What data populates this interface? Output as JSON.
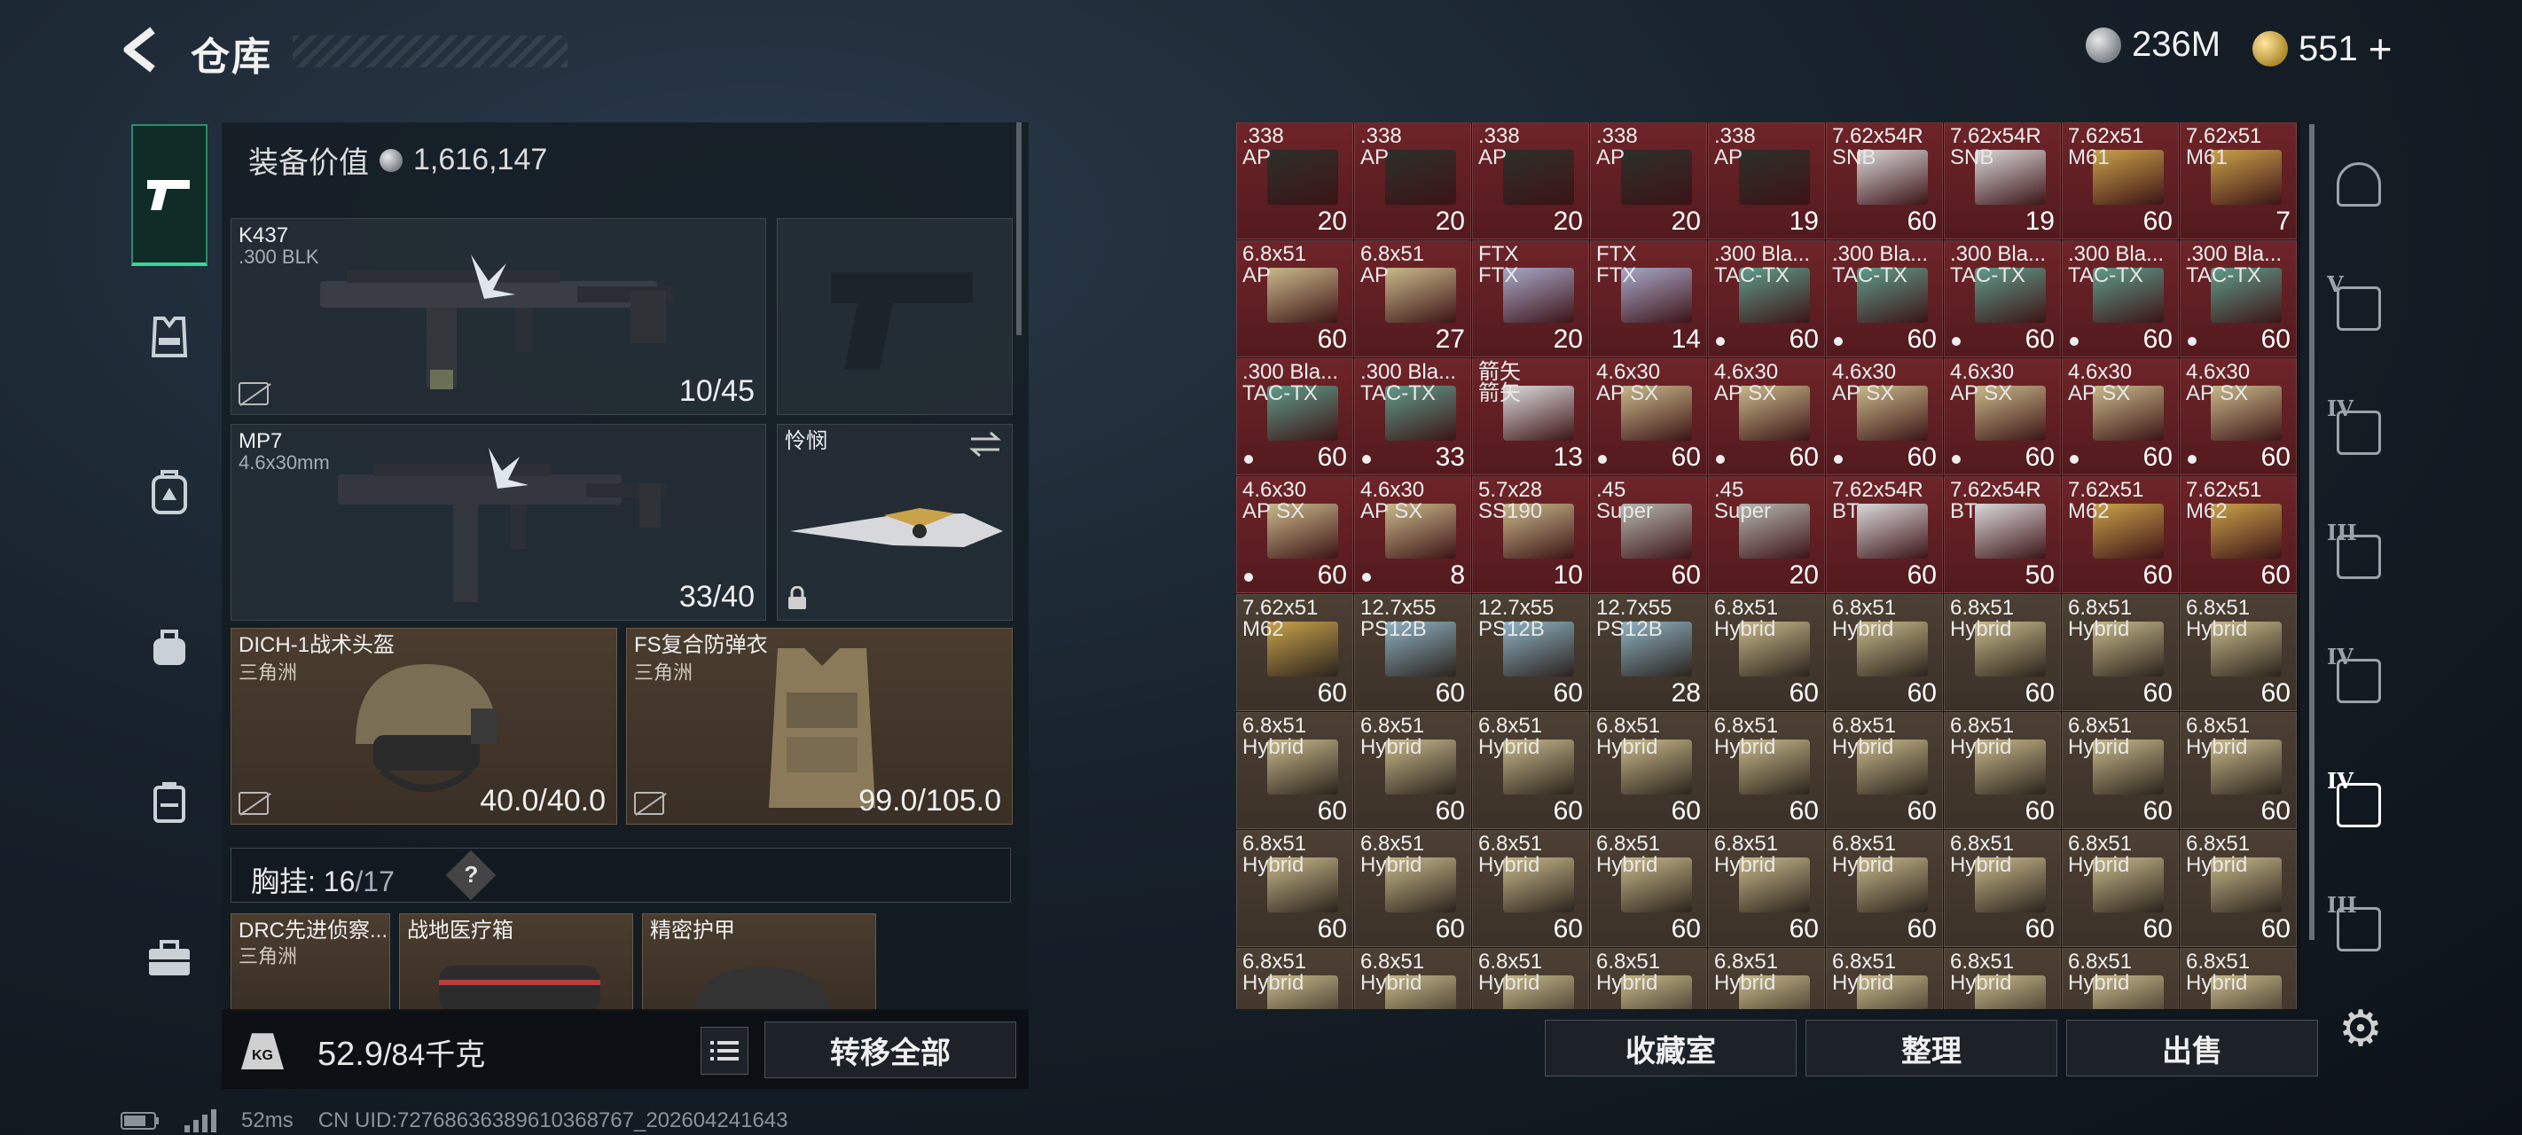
{
  "header": {
    "title": "仓库",
    "currency_silver": "236M",
    "currency_gold": "551",
    "currency_add": "+"
  },
  "equipment": {
    "value_label": "装备价值",
    "value": "1,616,147",
    "primary": {
      "name": "K437",
      "ammo": ".300 BLK",
      "count": "10/45"
    },
    "secondary": {
      "name": "MP7",
      "ammo": "4.6x30mm",
      "count": "33/40"
    },
    "melee": {
      "name": "怜悯"
    },
    "helmet": {
      "name": "DICH-1战术头盔",
      "origin": "三角洲",
      "durability": "40.0/40.0"
    },
    "armor": {
      "name": "FS复合防弹衣",
      "origin": "三角洲",
      "durability": "99.0/105.0"
    },
    "chest_rig": {
      "label": "胸挂: ",
      "used": "16",
      "capacity": "/17",
      "help": "?"
    },
    "rig_items": [
      {
        "name": "DRC先进侦察...",
        "origin": "三角洲"
      },
      {
        "name": "战地医疗箱",
        "origin": ""
      },
      {
        "name": "精密护甲",
        "origin": ""
      }
    ]
  },
  "footer_left": {
    "kg_icon": "KG",
    "weight_current": "52.9",
    "weight_max": "/84千克",
    "transfer_all": "转移全部"
  },
  "status_bar": {
    "ping": "52ms",
    "uid": "CN UID:7276863638961036876​7_202604241643"
  },
  "inventory": {
    "colors": {
      "red": "#6e2428",
      "brown": "#4c3f33"
    },
    "cells": [
      [
        {
          "l1": ".338",
          "l2": "AP",
          "q": "20",
          "bg": "red",
          "box": "#2b2f2a"
        },
        {
          "l1": ".338",
          "l2": "AP",
          "q": "20",
          "bg": "red",
          "box": "#2b2f2a"
        },
        {
          "l1": ".338",
          "l2": "AP",
          "q": "20",
          "bg": "red",
          "box": "#2b2f2a"
        },
        {
          "l1": ".338",
          "l2": "AP",
          "q": "20",
          "bg": "red",
          "box": "#2b2f2a"
        },
        {
          "l1": ".338",
          "l2": "AP",
          "q": "19",
          "bg": "red",
          "box": "#2b2f2a"
        },
        {
          "l1": "7.62x54R",
          "l2": "SNB",
          "q": "60",
          "bg": "red",
          "box": "#d9d9d9"
        },
        {
          "l1": "7.62x54R",
          "l2": "SNB",
          "q": "19",
          "bg": "red",
          "box": "#d9d9d9"
        },
        {
          "l1": "7.62x51",
          "l2": "M61",
          "q": "60",
          "bg": "red",
          "box": "#c9a24a"
        },
        {
          "l1": "7.62x51",
          "l2": "M61",
          "q": "7",
          "bg": "red",
          "box": "#c9a24a"
        }
      ],
      [
        {
          "l1": "6.8x51",
          "l2": "AP",
          "q": "60",
          "bg": "red",
          "box": "#c8b98a"
        },
        {
          "l1": "6.8x51",
          "l2": "AP",
          "q": "27",
          "bg": "red",
          "box": "#c8b98a"
        },
        {
          "l1": "FTX",
          "l2": "FTX",
          "q": "20",
          "bg": "red",
          "box": "#a7a9c9"
        },
        {
          "l1": "FTX",
          "l2": "FTX",
          "q": "14",
          "bg": "red",
          "box": "#a7a9c9"
        },
        {
          "l1": ".300 Bla...",
          "l2": "TAC-TX",
          "q": "60",
          "bg": "red",
          "box": "#5e9c8a",
          "dot": true
        },
        {
          "l1": ".300 Bla...",
          "l2": "TAC-TX",
          "q": "60",
          "bg": "red",
          "box": "#5e9c8a",
          "dot": true
        },
        {
          "l1": ".300 Bla...",
          "l2": "TAC-TX",
          "q": "60",
          "bg": "red",
          "box": "#5e9c8a",
          "dot": true
        },
        {
          "l1": ".300 Bla...",
          "l2": "TAC-TX",
          "q": "60",
          "bg": "red",
          "box": "#5e9c8a",
          "dot": true
        },
        {
          "l1": ".300 Bla...",
          "l2": "TAC-TX",
          "q": "60",
          "bg": "red",
          "box": "#5e9c8a",
          "dot": true
        }
      ],
      [
        {
          "l1": ".300 Bla...",
          "l2": "TAC-TX",
          "q": "60",
          "bg": "red",
          "box": "#5e9c8a",
          "dot": true
        },
        {
          "l1": ".300 Bla...",
          "l2": "TAC-TX",
          "q": "33",
          "bg": "red",
          "box": "#5e9c8a",
          "dot": true
        },
        {
          "l1": "箭矢",
          "l2": "箭矢",
          "q": "13",
          "bg": "red",
          "box": "#dcdcdc"
        },
        {
          "l1": "4.6x30",
          "l2": "AP SX",
          "q": "60",
          "bg": "red",
          "box": "#c8b98a",
          "dot": true
        },
        {
          "l1": "4.6x30",
          "l2": "AP SX",
          "q": "60",
          "bg": "red",
          "box": "#c8b98a",
          "dot": true
        },
        {
          "l1": "4.6x30",
          "l2": "AP SX",
          "q": "60",
          "bg": "red",
          "box": "#c8b98a",
          "dot": true
        },
        {
          "l1": "4.6x30",
          "l2": "AP SX",
          "q": "60",
          "bg": "red",
          "box": "#c8b98a",
          "dot": true
        },
        {
          "l1": "4.6x30",
          "l2": "AP SX",
          "q": "60",
          "bg": "red",
          "box": "#c8b98a",
          "dot": true
        },
        {
          "l1": "4.6x30",
          "l2": "AP SX",
          "q": "60",
          "bg": "red",
          "box": "#c8b98a",
          "dot": true
        }
      ],
      [
        {
          "l1": "4.6x30",
          "l2": "AP SX",
          "q": "60",
          "bg": "red",
          "box": "#c8b98a",
          "dot": true
        },
        {
          "l1": "4.6x30",
          "l2": "AP SX",
          "q": "8",
          "bg": "red",
          "box": "#c8b98a",
          "dot": true
        },
        {
          "l1": "5.7x28",
          "l2": "SS190",
          "q": "10",
          "bg": "red",
          "box": "#c8b98a"
        },
        {
          "l1": ".45",
          "l2": "Super",
          "q": "60",
          "bg": "red",
          "box": "#b5b8b0"
        },
        {
          "l1": ".45",
          "l2": "Super",
          "q": "20",
          "bg": "red",
          "box": "#b5b8b0"
        },
        {
          "l1": "7.62x54R",
          "l2": "BT",
          "q": "60",
          "bg": "red",
          "box": "#d9d9d9"
        },
        {
          "l1": "7.62x54R",
          "l2": "BT",
          "q": "50",
          "bg": "red",
          "box": "#d9d9d9"
        },
        {
          "l1": "7.62x51",
          "l2": "M62",
          "q": "60",
          "bg": "red",
          "box": "#c9a24a"
        },
        {
          "l1": "7.62x51",
          "l2": "M62",
          "q": "60",
          "bg": "red",
          "box": "#c9a24a"
        }
      ],
      [
        {
          "l1": "7.62x51",
          "l2": "M62",
          "q": "60",
          "bg": "brn",
          "box": "#c9a24a"
        },
        {
          "l1": "12.7x55",
          "l2": "PS12B",
          "q": "60",
          "bg": "brn",
          "box": "#8fb2c4"
        },
        {
          "l1": "12.7x55",
          "l2": "PS12B",
          "q": "60",
          "bg": "brn",
          "box": "#8fb2c4"
        },
        {
          "l1": "12.7x55",
          "l2": "PS12B",
          "q": "28",
          "bg": "brn",
          "box": "#8fb2c4"
        },
        {
          "l1": "6.8x51",
          "l2": "Hybrid",
          "q": "60",
          "bg": "brn",
          "box": "#c8b98a"
        },
        {
          "l1": "6.8x51",
          "l2": "Hybrid",
          "q": "60",
          "bg": "brn",
          "box": "#c8b98a"
        },
        {
          "l1": "6.8x51",
          "l2": "Hybrid",
          "q": "60",
          "bg": "brn",
          "box": "#c8b98a"
        },
        {
          "l1": "6.8x51",
          "l2": "Hybrid",
          "q": "60",
          "bg": "brn",
          "box": "#c8b98a"
        },
        {
          "l1": "6.8x51",
          "l2": "Hybrid",
          "q": "60",
          "bg": "brn",
          "box": "#c8b98a"
        }
      ],
      [
        {
          "l1": "6.8x51",
          "l2": "Hybrid",
          "q": "60",
          "bg": "brn",
          "box": "#c8b98a"
        },
        {
          "l1": "6.8x51",
          "l2": "Hybrid",
          "q": "60",
          "bg": "brn",
          "box": "#c8b98a"
        },
        {
          "l1": "6.8x51",
          "l2": "Hybrid",
          "q": "60",
          "bg": "brn",
          "box": "#c8b98a"
        },
        {
          "l1": "6.8x51",
          "l2": "Hybrid",
          "q": "60",
          "bg": "brn",
          "box": "#c8b98a"
        },
        {
          "l1": "6.8x51",
          "l2": "Hybrid",
          "q": "60",
          "bg": "brn",
          "box": "#c8b98a"
        },
        {
          "l1": "6.8x51",
          "l2": "Hybrid",
          "q": "60",
          "bg": "brn",
          "box": "#c8b98a"
        },
        {
          "l1": "6.8x51",
          "l2": "Hybrid",
          "q": "60",
          "bg": "brn",
          "box": "#c8b98a"
        },
        {
          "l1": "6.8x51",
          "l2": "Hybrid",
          "q": "60",
          "bg": "brn",
          "box": "#c8b98a"
        },
        {
          "l1": "6.8x51",
          "l2": "Hybrid",
          "q": "60",
          "bg": "brn",
          "box": "#c8b98a"
        }
      ],
      [
        {
          "l1": "6.8x51",
          "l2": "Hybrid",
          "q": "60",
          "bg": "brn",
          "box": "#c8b98a"
        },
        {
          "l1": "6.8x51",
          "l2": "Hybrid",
          "q": "60",
          "bg": "brn",
          "box": "#c8b98a"
        },
        {
          "l1": "6.8x51",
          "l2": "Hybrid",
          "q": "60",
          "bg": "brn",
          "box": "#c8b98a"
        },
        {
          "l1": "6.8x51",
          "l2": "Hybrid",
          "q": "60",
          "bg": "brn",
          "box": "#c8b98a"
        },
        {
          "l1": "6.8x51",
          "l2": "Hybrid",
          "q": "60",
          "bg": "brn",
          "box": "#c8b98a"
        },
        {
          "l1": "6.8x51",
          "l2": "Hybrid",
          "q": "60",
          "bg": "brn",
          "box": "#c8b98a"
        },
        {
          "l1": "6.8x51",
          "l2": "Hybrid",
          "q": "60",
          "bg": "brn",
          "box": "#c8b98a"
        },
        {
          "l1": "6.8x51",
          "l2": "Hybrid",
          "q": "60",
          "bg": "brn",
          "box": "#c8b98a"
        },
        {
          "l1": "6.8x51",
          "l2": "Hybrid",
          "q": "60",
          "bg": "brn",
          "box": "#c8b98a"
        }
      ],
      [
        {
          "l1": "6.8x51",
          "l2": "Hybrid",
          "q": "",
          "bg": "brn",
          "box": "#c8b98a"
        },
        {
          "l1": "6.8x51",
          "l2": "Hybrid",
          "q": "",
          "bg": "brn",
          "box": "#c8b98a"
        },
        {
          "l1": "6.8x51",
          "l2": "Hybrid",
          "q": "",
          "bg": "brn",
          "box": "#c8b98a"
        },
        {
          "l1": "6.8x51",
          "l2": "Hybrid",
          "q": "",
          "bg": "brn",
          "box": "#c8b98a"
        },
        {
          "l1": "6.8x51",
          "l2": "Hybrid",
          "q": "",
          "bg": "brn",
          "box": "#c8b98a"
        },
        {
          "l1": "6.8x51",
          "l2": "Hybrid",
          "q": "",
          "bg": "brn",
          "box": "#c8b98a"
        },
        {
          "l1": "6.8x51",
          "l2": "Hybrid",
          "q": "",
          "bg": "brn",
          "box": "#c8b98a"
        },
        {
          "l1": "6.8x51",
          "l2": "Hybrid",
          "q": "",
          "bg": "brn",
          "box": "#c8b98a"
        },
        {
          "l1": "6.8x51",
          "l2": "Hybrid",
          "q": "",
          "bg": "brn",
          "box": "#c8b98a"
        }
      ]
    ]
  },
  "right_tabs": [
    {
      "icon": "vault-door-icon",
      "roman": ""
    },
    {
      "icon": "case-tier-v-icon",
      "roman": "V"
    },
    {
      "icon": "case-tier-iv-icon",
      "roman": "IV"
    },
    {
      "icon": "case-tier-iii-icon",
      "roman": "III"
    },
    {
      "icon": "case-tier-iv-icon",
      "roman": "IV"
    },
    {
      "icon": "ammo-box-tier-iv-icon",
      "roman": "IV"
    },
    {
      "icon": "case-tier-iii-icon",
      "roman": "III"
    }
  ],
  "footer_right": {
    "collection": "收藏室",
    "sort": "整理",
    "sell": "出售"
  }
}
